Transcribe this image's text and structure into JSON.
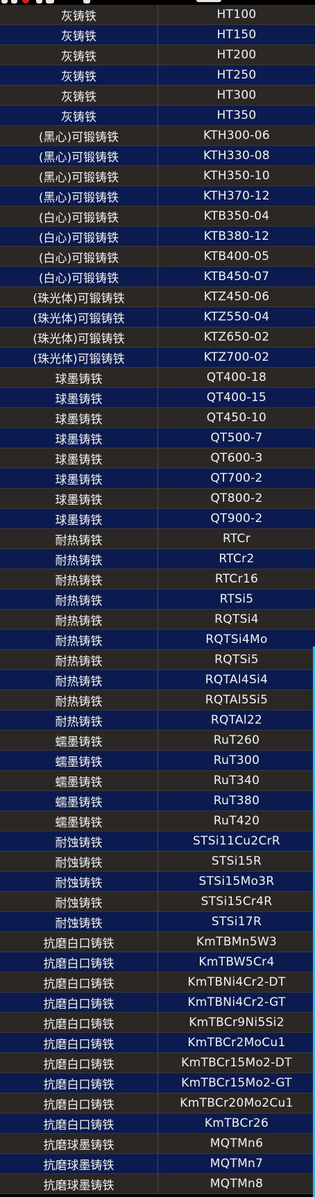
{
  "colors": {
    "row_even": "#0c1b4f",
    "row_odd": "#2b2724",
    "text": "#f2f2f2",
    "scroll_indicator": "#33b5e5"
  },
  "rows": [
    {
      "name": "灰铸铁",
      "grade": "HT100"
    },
    {
      "name": "灰铸铁",
      "grade": "HT150"
    },
    {
      "name": "灰铸铁",
      "grade": "HT200"
    },
    {
      "name": "灰铸铁",
      "grade": "HT250"
    },
    {
      "name": "灰铸铁",
      "grade": "HT300"
    },
    {
      "name": "灰铸铁",
      "grade": "HT350"
    },
    {
      "name": "(黑心)可锻铸铁",
      "grade": "KTH300-06"
    },
    {
      "name": "(黑心)可锻铸铁",
      "grade": "KTH330-08"
    },
    {
      "name": "(黑心)可锻铸铁",
      "grade": "KTH350-10"
    },
    {
      "name": "(黑心)可锻铸铁",
      "grade": "KTH370-12"
    },
    {
      "name": "(白心)可锻铸铁",
      "grade": "KTB350-04"
    },
    {
      "name": "(白心)可锻铸铁",
      "grade": "KTB380-12"
    },
    {
      "name": "(白心)可锻铸铁",
      "grade": "KTB400-05"
    },
    {
      "name": "(白心)可锻铸铁",
      "grade": "KTB450-07"
    },
    {
      "name": "(珠光体)可锻铸铁",
      "grade": "KTZ450-06"
    },
    {
      "name": "(珠光体)可锻铸铁",
      "grade": "KTZ550-04"
    },
    {
      "name": "(珠光体)可锻铸铁",
      "grade": "KTZ650-02"
    },
    {
      "name": "(珠光体)可锻铸铁",
      "grade": "KTZ700-02"
    },
    {
      "name": "球墨铸铁",
      "grade": "QT400-18"
    },
    {
      "name": "球墨铸铁",
      "grade": "QT400-15"
    },
    {
      "name": "球墨铸铁",
      "grade": "QT450-10"
    },
    {
      "name": "球墨铸铁",
      "grade": "QT500-7"
    },
    {
      "name": "球墨铸铁",
      "grade": "QT600-3"
    },
    {
      "name": "球墨铸铁",
      "grade": "QT700-2"
    },
    {
      "name": "球墨铸铁",
      "grade": "QT800-2"
    },
    {
      "name": "球墨铸铁",
      "grade": "QT900-2"
    },
    {
      "name": "耐热铸铁",
      "grade": "RTCr"
    },
    {
      "name": "耐热铸铁",
      "grade": "RTCr2"
    },
    {
      "name": "耐热铸铁",
      "grade": "RTCr16"
    },
    {
      "name": "耐热铸铁",
      "grade": "RTSi5"
    },
    {
      "name": "耐热铸铁",
      "grade": "RQTSi4"
    },
    {
      "name": "耐热铸铁",
      "grade": "RQTSi4Mo"
    },
    {
      "name": "耐热铸铁",
      "grade": "RQTSi5"
    },
    {
      "name": "耐热铸铁",
      "grade": "RQTAl4Si4"
    },
    {
      "name": "耐热铸铁",
      "grade": "RQTAl5Si5"
    },
    {
      "name": "耐热铸铁",
      "grade": "RQTAl22"
    },
    {
      "name": "蠕墨铸铁",
      "grade": "RuT260"
    },
    {
      "name": "蠕墨铸铁",
      "grade": "RuT300"
    },
    {
      "name": "蠕墨铸铁",
      "grade": "RuT340"
    },
    {
      "name": "蠕墨铸铁",
      "grade": "RuT380"
    },
    {
      "name": "蠕墨铸铁",
      "grade": "RuT420"
    },
    {
      "name": "耐蚀铸铁",
      "grade": "STSi11Cu2CrR"
    },
    {
      "name": "耐蚀铸铁",
      "grade": "STSi15R"
    },
    {
      "name": "耐蚀铸铁",
      "grade": "STSi15Mo3R"
    },
    {
      "name": "耐蚀铸铁",
      "grade": "STSi15Cr4R"
    },
    {
      "name": "耐蚀铸铁",
      "grade": "STSi17R"
    },
    {
      "name": "抗磨白口铸铁",
      "grade": "KmTBMn5W3"
    },
    {
      "name": "抗磨白口铸铁",
      "grade": "KmTBW5Cr4"
    },
    {
      "name": "抗磨白口铸铁",
      "grade": "KmTBNi4Cr2-DT"
    },
    {
      "name": "抗磨白口铸铁",
      "grade": "KmTBNi4Cr2-GT"
    },
    {
      "name": "抗磨白口铸铁",
      "grade": "KmTBCr9Ni5Si2"
    },
    {
      "name": "抗磨白口铸铁",
      "grade": "KmTBCr2MoCu1"
    },
    {
      "name": "抗磨白口铸铁",
      "grade": "KmTBCr15Mo2-DT"
    },
    {
      "name": "抗磨白口铸铁",
      "grade": "KmTBCr15Mo2-GT"
    },
    {
      "name": "抗磨白口铸铁",
      "grade": "KmTBCr20Mo2Cu1"
    },
    {
      "name": "抗磨白口铸铁",
      "grade": "KmTBCr26"
    },
    {
      "name": "抗磨球墨铸铁",
      "grade": "MQTMn6"
    },
    {
      "name": "抗磨球墨铸铁",
      "grade": "MQTMn7"
    },
    {
      "name": "抗磨球墨铸铁",
      "grade": "MQTMn8"
    }
  ]
}
